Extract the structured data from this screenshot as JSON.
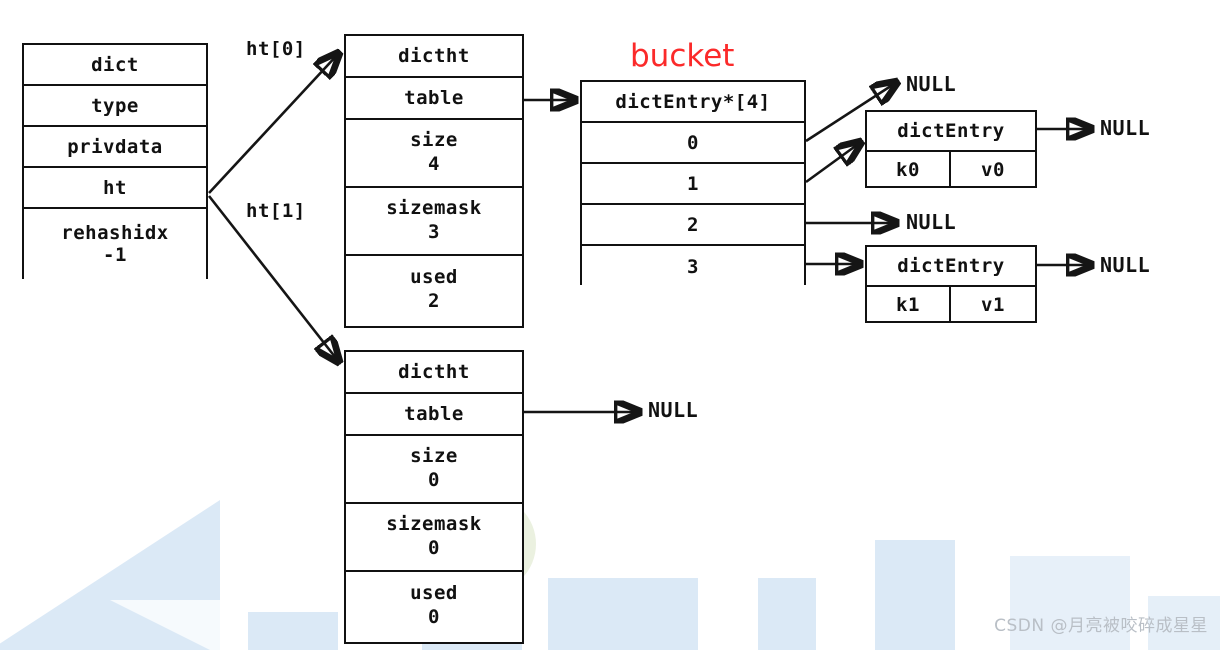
{
  "diagram": {
    "title_label_bucket": "bucket",
    "pointer_labels": {
      "ht0": "ht[0]",
      "ht1": "ht[1]"
    },
    "null_labels": {
      "bucket0": "NULL",
      "entry0_next": "NULL",
      "bucket2": "NULL",
      "entry1_next": "NULL",
      "dictht1_table": "NULL"
    },
    "colors": {
      "bucket_label": "#fb2a2a",
      "stroke": "#151515",
      "box_fill": "#ffffff",
      "watermark_blue": "#cfe2f3",
      "watermark_green": "#e7eedb",
      "watermark_text": "#b9bfc6"
    }
  },
  "dict_struct": {
    "title": "dict",
    "fields": [
      {
        "label": "type",
        "value": ""
      },
      {
        "label": "privdata",
        "value": ""
      },
      {
        "label": "ht",
        "value": ""
      },
      {
        "label": "rehashidx",
        "value": "-1"
      }
    ]
  },
  "dictht_tables": [
    {
      "title": "dictht",
      "table_label": "table",
      "fields": [
        {
          "label": "size",
          "value": "4"
        },
        {
          "label": "sizemask",
          "value": "3"
        },
        {
          "label": "used",
          "value": "2"
        }
      ]
    },
    {
      "title": "dictht",
      "table_label": "table",
      "fields": [
        {
          "label": "size",
          "value": "0"
        },
        {
          "label": "sizemask",
          "value": "0"
        },
        {
          "label": "used",
          "value": "0"
        }
      ]
    }
  ],
  "bucket_array": {
    "header": "dictEntry*[4]",
    "indices": [
      "0",
      "1",
      "2",
      "3"
    ]
  },
  "dict_entries": [
    {
      "title": "dictEntry",
      "key": "k0",
      "value": "v0"
    },
    {
      "title": "dictEntry",
      "key": "k1",
      "value": "v1"
    }
  ],
  "watermark": {
    "text": "CSDN @月亮被咬碎成星星"
  }
}
